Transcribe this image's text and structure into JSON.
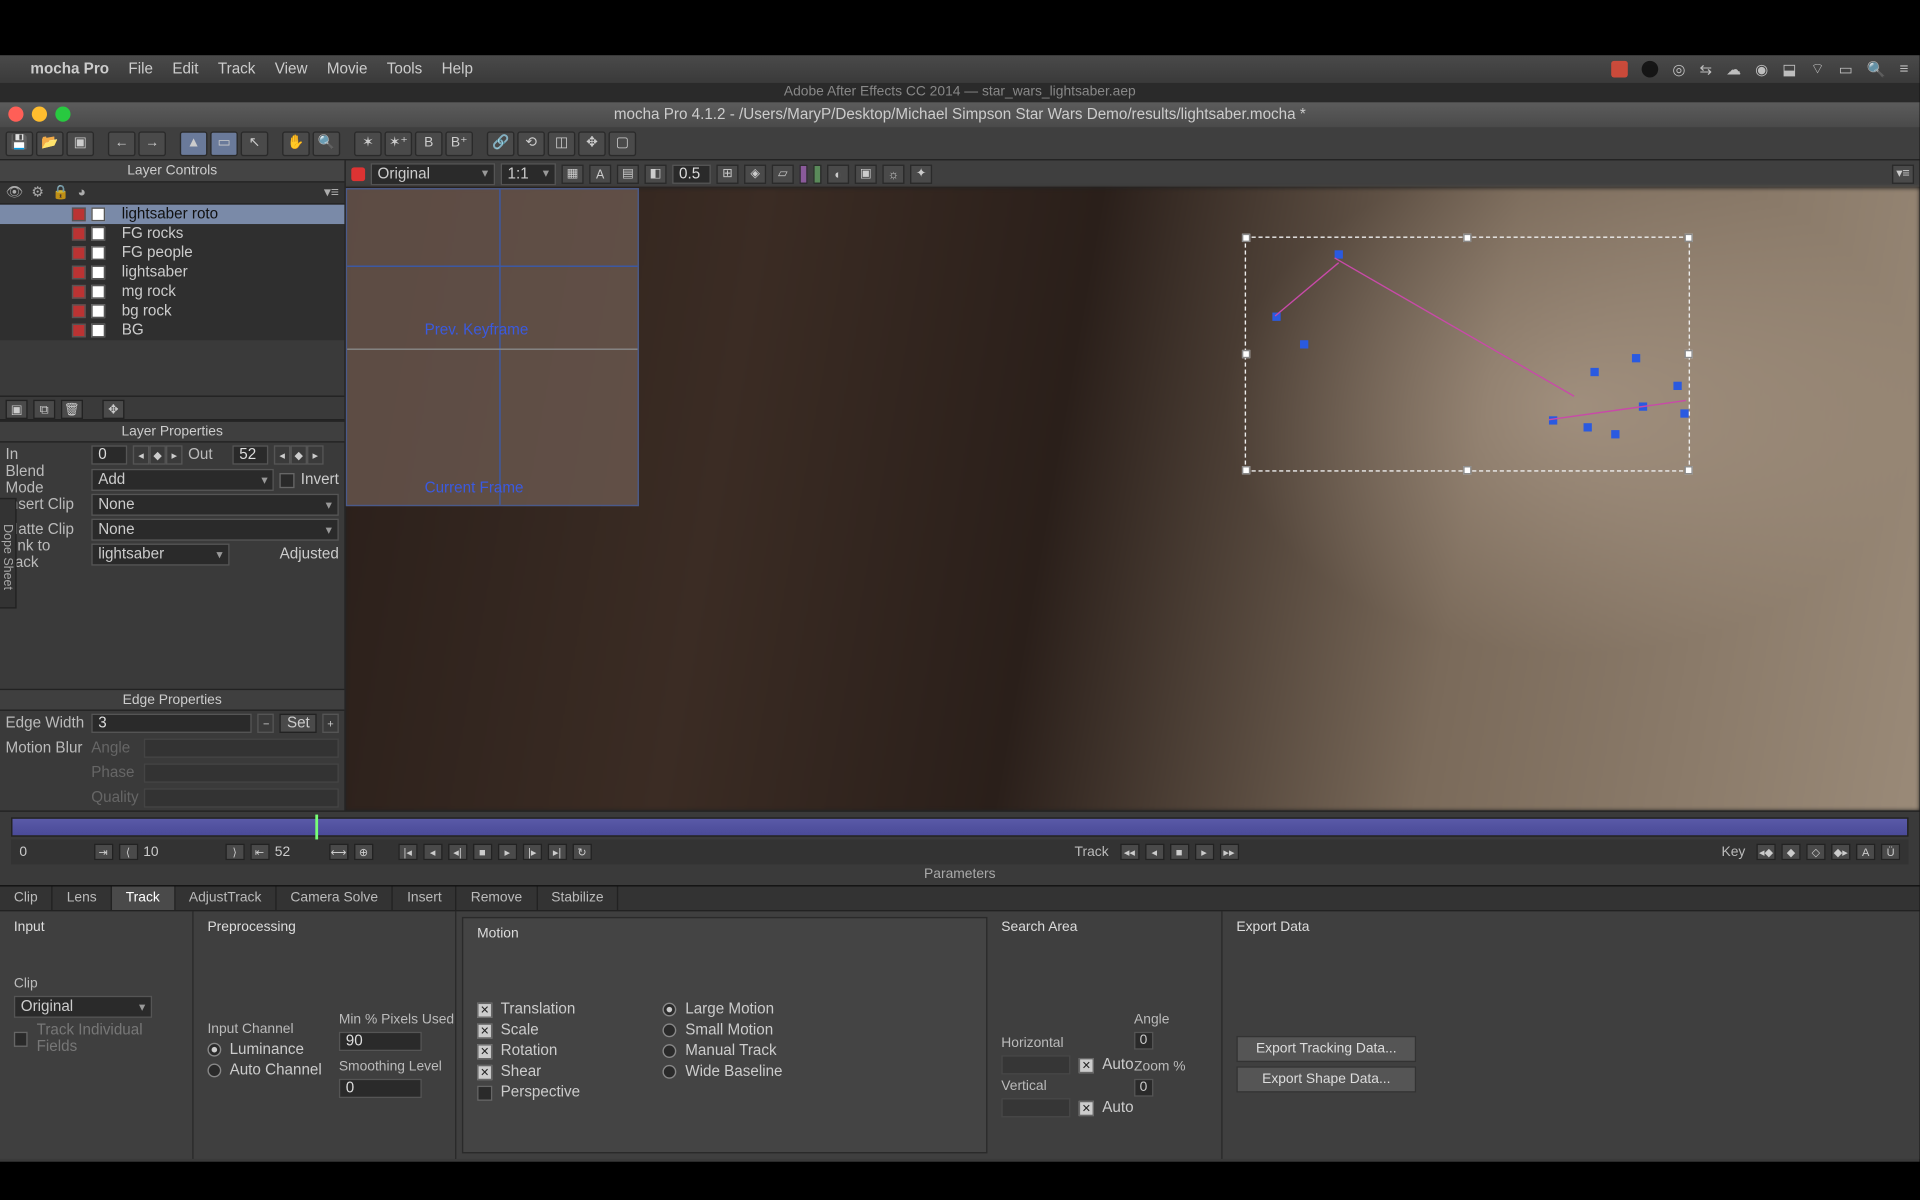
{
  "menubar": {
    "app": "mocha Pro",
    "items": [
      "File",
      "Edit",
      "Track",
      "View",
      "Movie",
      "Tools",
      "Help"
    ]
  },
  "ae_tab": "Adobe After Effects CC 2014 — star_wars_lightsaber.aep",
  "window_title": "mocha Pro 4.1.2 - /Users/MaryP/Desktop/Michael Simpson Star Wars Demo/results/lightsaber.mocha *",
  "layer_controls_title": "Layer Controls",
  "layers": [
    {
      "name": "lightsaber roto",
      "selected": true
    },
    {
      "name": "FG rocks"
    },
    {
      "name": "FG people"
    },
    {
      "name": "lightsaber"
    },
    {
      "name": "mg rock"
    },
    {
      "name": "bg rock"
    },
    {
      "name": "BG"
    }
  ],
  "layer_props_title": "Layer Properties",
  "props": {
    "in_label": "In",
    "in_val": "0",
    "out_label": "Out",
    "out_val": "52",
    "blend_label": "Blend Mode",
    "blend_val": "Add",
    "invert": "Invert",
    "insert_label": "Insert Clip",
    "insert_val": "None",
    "matte_label": "Matte Clip",
    "matte_val": "None",
    "link_label": "Link to track",
    "link_val": "lightsaber",
    "adjusted": "Adjusted"
  },
  "edge_props_title": "Edge Properties",
  "edge": {
    "width_label": "Edge Width",
    "width_val": "3",
    "set": "Set",
    "mb_label": "Motion Blur",
    "angle": "Angle",
    "phase": "Phase",
    "quality": "Quality"
  },
  "viewer": {
    "clip": "Original",
    "zoom": "1:1",
    "opacity": "0.5",
    "prev_kf": "Prev. Keyframe",
    "cur_frame": "Current Frame"
  },
  "timeline": {
    "start": "0",
    "mid": "10",
    "cur": "52",
    "track_label": "Track",
    "key_label": "Key"
  },
  "tabs": [
    "Clip",
    "Lens",
    "Track",
    "AdjustTrack",
    "Camera Solve",
    "Insert",
    "Remove",
    "Stabilize"
  ],
  "active_tab": "Track",
  "params": {
    "title": "Parameters",
    "input": "Input",
    "preproc": "Preprocessing",
    "motion": "Motion",
    "search": "Search Area",
    "export": "Export Data",
    "clip_label": "Clip",
    "clip_val": "Original",
    "track_individual": "Track Individual Fields",
    "input_channel": "Input Channel",
    "luminance": "Luminance",
    "auto_channel": "Auto Channel",
    "min_pct": "Min % Pixels Used",
    "min_pct_val": "90",
    "smooth": "Smoothing Level",
    "smooth_val": "0",
    "translation": "Translation",
    "scale": "Scale",
    "rotation": "Rotation",
    "shear": "Shear",
    "perspective": "Perspective",
    "large": "Large Motion",
    "small": "Small Motion",
    "manual": "Manual Track",
    "wide": "Wide Baseline",
    "horiz": "Horizontal",
    "vert": "Vertical",
    "auto": "Auto",
    "angle_l": "Angle",
    "angle_v": "0",
    "zoom_l": "Zoom %",
    "zoom_v": "0",
    "exp_track": "Export Tracking Data...",
    "exp_shape": "Export Shape Data..."
  },
  "dope": "Dope Sheet"
}
